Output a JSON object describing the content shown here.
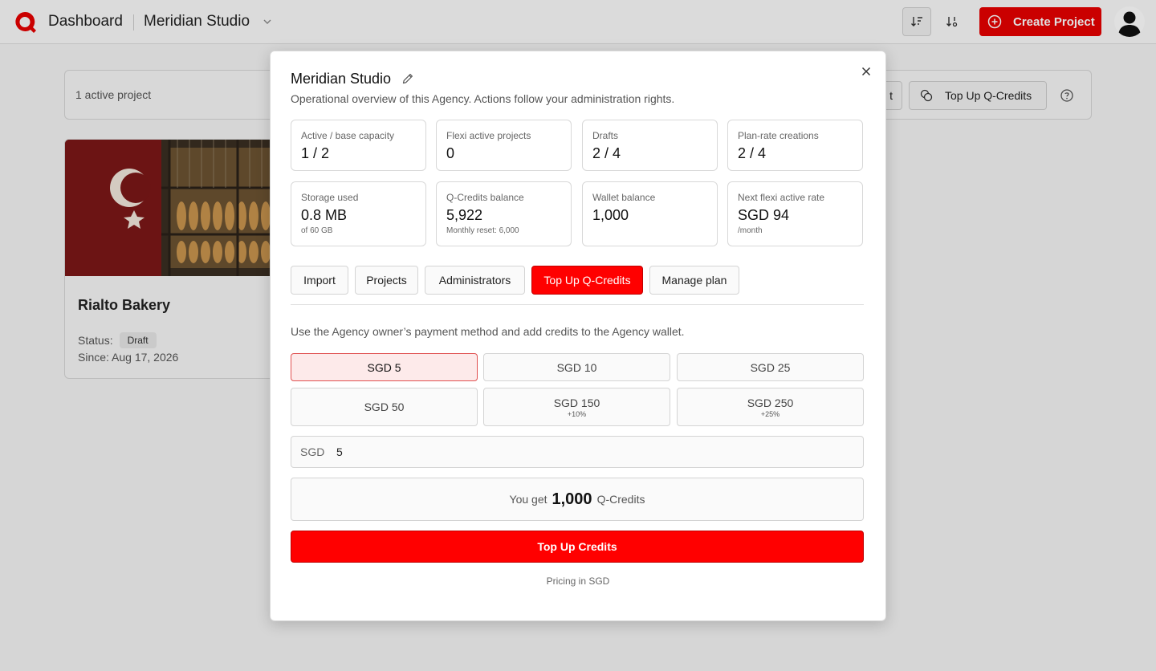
{
  "header": {
    "nav_title": "Dashboard",
    "org_name": "Meridian Studio",
    "create_label": "Create Project",
    "brand_color": "#e60000"
  },
  "background": {
    "active_count": "1 active project",
    "partial_button_label": "t",
    "topup_label": "Top Up Q-Credits",
    "project": {
      "name": "Rialto Bakery",
      "status_label": "Status:",
      "status": "Draft",
      "since": "Since: Aug 17, 2026"
    }
  },
  "modal": {
    "title": "Meridian Studio",
    "subtitle": "Operational overview of this Agency. Actions follow your administration rights.",
    "stats": [
      {
        "label": "Active / base capacity",
        "value": "1 / 2",
        "note": ""
      },
      {
        "label": "Flexi active projects",
        "value": "0",
        "note": ""
      },
      {
        "label": "Drafts",
        "value": "2 / 4",
        "note": ""
      },
      {
        "label": "Plan-rate creations",
        "value": "2 / 4",
        "note": ""
      },
      {
        "label": "Storage used",
        "value": "0.8 MB",
        "note": "of 60 GB"
      },
      {
        "label": "Q-Credits balance",
        "value": "5,922",
        "note": "Monthly reset: 6,000"
      },
      {
        "label": "Wallet balance",
        "value": "1,000",
        "note": ""
      },
      {
        "label": "Next flexi active rate",
        "value": "SGD 94",
        "note": "/month"
      }
    ],
    "tabs": [
      "Import",
      "Projects",
      "Administrators",
      "Top Up Q-Credits",
      "Manage plan"
    ],
    "active_tab": "Top Up Q-Credits",
    "topup": {
      "note": "Use the Agency owner’s payment method and add credits to the Agency wallet.",
      "amounts": [
        {
          "label": "SGD 5",
          "bonus": "",
          "selected": true
        },
        {
          "label": "SGD 10",
          "bonus": "",
          "selected": false
        },
        {
          "label": "SGD 25",
          "bonus": "",
          "selected": false
        },
        {
          "label": "SGD 50",
          "bonus": "",
          "selected": false
        },
        {
          "label": "SGD 150",
          "bonus": "+10%",
          "selected": false
        },
        {
          "label": "SGD 250",
          "bonus": "+25%",
          "selected": false
        }
      ],
      "currency": "SGD",
      "amount_value": "5",
      "result_prefix": "You get",
      "result_amount": "1,000",
      "result_suffix": "Q-Credits",
      "submit_label": "Top Up Credits",
      "pricing_note": "Pricing in SGD"
    }
  }
}
